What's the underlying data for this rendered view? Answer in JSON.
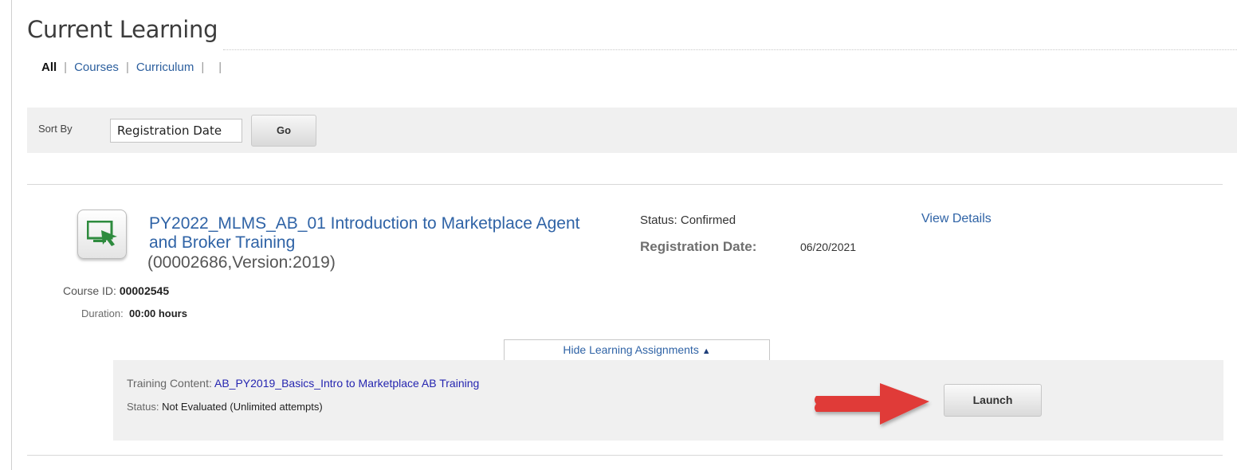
{
  "page": {
    "title": "Current Learning"
  },
  "filters": {
    "all": "All",
    "courses": "Courses",
    "curriculum": "Curriculum",
    "separator": "|"
  },
  "sort": {
    "label": "Sort By",
    "selected": "Registration Date",
    "go_label": "Go"
  },
  "course": {
    "title": "PY2022_MLMS_AB_01 Introduction to Marketplace Agent and Broker Training",
    "code_version": "(00002686,Version:2019)",
    "course_id_label": "Course ID:",
    "course_id": "00002545",
    "duration_label": "Duration:",
    "duration": "00:00 hours",
    "status_label": "Status:",
    "status": "Confirmed",
    "registration_date_label": "Registration Date:",
    "registration_date": "06/20/2021",
    "view_details": "View Details",
    "icon": "monitor-cursor-icon"
  },
  "assignments": {
    "toggle_label": "Hide Learning Assignments",
    "toggle_icon": "triangle-up-icon",
    "training_content_label": "Training Content:",
    "training_content": "AB_PY2019_Basics_Intro to Marketplace AB Training",
    "status_label": "Status:",
    "status": "Not Evaluated (Unlimited attempts)",
    "launch_label": "Launch",
    "annotation_icon": "red-arrow-icon"
  },
  "colors": {
    "link": "#2f63a6",
    "content_link": "#2525b0",
    "panel_bg": "#f0f0f0",
    "arrow": "#e03a37",
    "icon_green": "#2e8b3e"
  }
}
